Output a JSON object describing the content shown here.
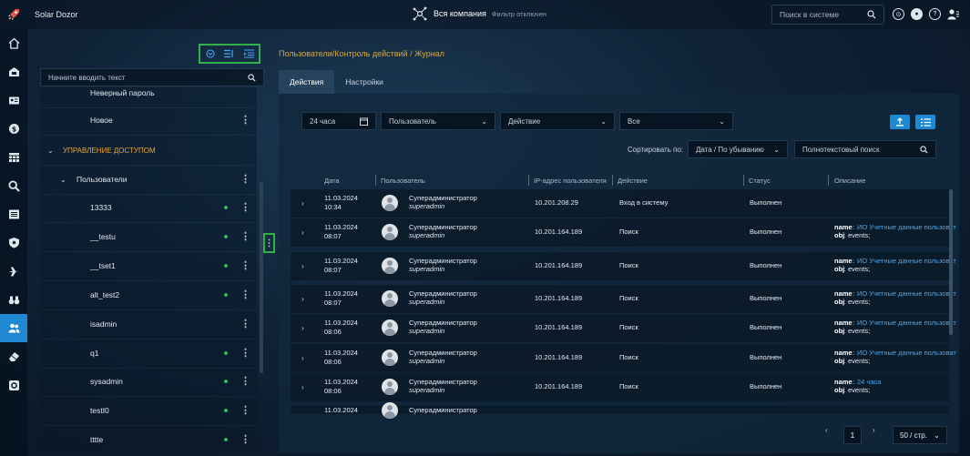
{
  "app": {
    "title": "Solar Dozor",
    "company": "Вся компания",
    "filter_state": "Фильтр отключен",
    "search_placeholder": "Поиск в системе"
  },
  "nav": {
    "items": [
      "home",
      "workstation",
      "id-card",
      "dollar",
      "calendar",
      "search",
      "list",
      "shield",
      "plane",
      "binoculars",
      "users",
      "eraser",
      "settings"
    ],
    "active": "users"
  },
  "tree": {
    "search_placeholder": "Начните вводить текст",
    "rows": [
      {
        "label": "Неверный пароль",
        "indent": 2,
        "dot": false,
        "kebab": false,
        "partial": true
      },
      {
        "label": "Новое",
        "indent": 2,
        "dot": false,
        "kebab": true
      },
      {
        "label": "УПРАВЛЕНИЕ ДОСТУПОМ",
        "indent": 0,
        "dot": false,
        "kebab": false,
        "section": true,
        "chevron": true
      },
      {
        "label": "Пользователи",
        "indent": 1,
        "dot": false,
        "kebab": true,
        "chevron": true
      },
      {
        "label": "13333",
        "indent": 2,
        "dot": true,
        "kebab": true
      },
      {
        "label": "__testu",
        "indent": 2,
        "dot": true,
        "kebab": true
      },
      {
        "label": "__tset1",
        "indent": 2,
        "dot": true,
        "kebab": true
      },
      {
        "label": "alt_test2",
        "indent": 2,
        "dot": true,
        "kebab": true
      },
      {
        "label": "isadmin",
        "indent": 2,
        "dot": false,
        "kebab": true
      },
      {
        "label": "q1",
        "indent": 2,
        "dot": true,
        "kebab": true
      },
      {
        "label": "sysadmin",
        "indent": 2,
        "dot": true,
        "kebab": true
      },
      {
        "label": "testI0",
        "indent": 2,
        "dot": true,
        "kebab": true
      },
      {
        "label": "tttte",
        "indent": 2,
        "dot": true,
        "kebab": true
      }
    ]
  },
  "main": {
    "breadcrumb": "Пользователи/Контроль действий / Журнал",
    "tabs": [
      "Действия",
      "Настройки"
    ],
    "active_tab": "Действия",
    "filters": {
      "period": "24 часа",
      "user": "Пользователь",
      "action": "Действие",
      "scope": "Все"
    },
    "sort_label": "Сортировать по:",
    "sort_value": "Дата / По убыванию",
    "fulltext_placeholder": "Полнотекстовый поиск",
    "columns": [
      "Дата",
      "Пользователь",
      "IP-адрес пользователя",
      "Действие",
      "Статус",
      "Описание"
    ],
    "rows": [
      {
        "date": "11.03.2024",
        "time": "10:34",
        "user": "Суперадминистратор",
        "login": "superadmin",
        "ip": "10.201.208.29",
        "action": "Вход в систему",
        "status": "Выполнен",
        "desc": []
      },
      {
        "date": "11.03.2024",
        "time": "08:07",
        "user": "Суперадминистратор",
        "login": "superadmin",
        "ip": "10.201.164.189",
        "action": "Поиск",
        "status": "Выполнен",
        "desc": [
          {
            "k": "name",
            "v": "ИО Учетные данные пользоват"
          },
          {
            "k": "obj",
            "v": "events;"
          }
        ]
      },
      {
        "date": "11.03.2024",
        "time": "08:07",
        "user": "Суперадминистратор",
        "login": "superadmin",
        "ip": "10.201.164.189",
        "action": "Поиск",
        "status": "Выполнен",
        "desc": [
          {
            "k": "name",
            "v": "ИО Учетные данные пользоват"
          },
          {
            "k": "obj",
            "v": "events;"
          }
        ]
      },
      {
        "date": "11.03.2024",
        "time": "08:07",
        "user": "Суперадминистратор",
        "login": "superadmin",
        "ip": "10.201.164.189",
        "action": "Поиск",
        "status": "Выполнен",
        "desc": [
          {
            "k": "name",
            "v": "ИО Учетные данные пользоват"
          },
          {
            "k": "obj",
            "v": "events;"
          }
        ]
      },
      {
        "date": "11.03.2024",
        "time": "08:06",
        "user": "Суперадминистратор",
        "login": "superadmin",
        "ip": "10.201.164.189",
        "action": "Поиск",
        "status": "Выполнен",
        "desc": [
          {
            "k": "name",
            "v": "ИО Учетные данные пользоват"
          },
          {
            "k": "obj",
            "v": "events;"
          }
        ]
      },
      {
        "date": "11.03.2024",
        "time": "08:06",
        "user": "Суперадминистратор",
        "login": "superadmin",
        "ip": "10.201.164.189",
        "action": "Поиск",
        "status": "Выполнен",
        "desc": [
          {
            "k": "name",
            "v": "ИО Учетные данные пользоват"
          },
          {
            "k": "obj",
            "v": "events;"
          }
        ]
      },
      {
        "date": "11.03.2024",
        "time": "08:06",
        "user": "Суперадминистратор",
        "login": "superadmin",
        "ip": "10.201.164.189",
        "action": "Поиск",
        "status": "Выполнен",
        "desc": [
          {
            "k": "name",
            "v": "24 часа"
          },
          {
            "k": "obj",
            "v": "events;"
          }
        ]
      },
      {
        "date": "11.03.2024",
        "time": "",
        "user": "Суперадминистратор",
        "login": "",
        "ip": "",
        "action": "",
        "status": "",
        "desc": [],
        "partial": true
      }
    ],
    "pagination": {
      "page": "1",
      "page_size": "50 / стр."
    }
  },
  "colors": {
    "accent": "#1e88d3",
    "highlight": "#2fb04a",
    "crumb": "#d9a640",
    "online": "#2fb55a",
    "link": "#4aa6ef"
  }
}
